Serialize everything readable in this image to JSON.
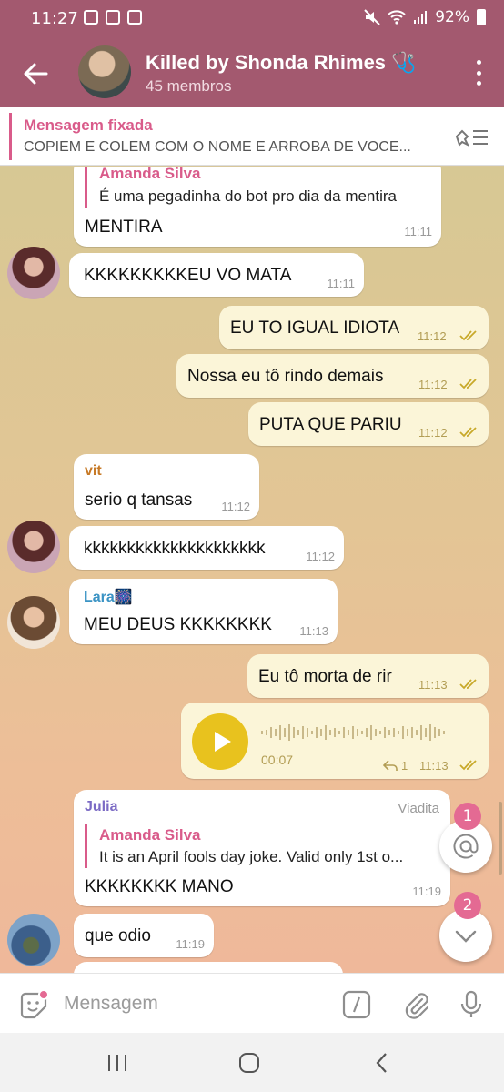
{
  "status_bar": {
    "time": "11:27",
    "battery": "92%"
  },
  "header": {
    "title": "Killed by Shonda Rhimes 🩺",
    "subtitle": "45 membros"
  },
  "pinned": {
    "label": "Mensagem fixada",
    "text": "COPIEM E COLEM COM O NOME E ARROBA DE VOCE..."
  },
  "messages": [
    {
      "id": "m0",
      "reply_name": "Amanda Silva",
      "reply_text": "É uma pegadinha do bot pro dia da mentira",
      "text": "MENTIRA",
      "time": "11:11"
    },
    {
      "id": "m1",
      "text": "KKKKKKKKKEU VO MATA",
      "time": "11:11"
    },
    {
      "id": "m2",
      "text": "EU TO IGUAL IDIOTA",
      "time": "11:12"
    },
    {
      "id": "m3",
      "text": "Nossa eu tô rindo demais",
      "time": "11:12"
    },
    {
      "id": "m4",
      "text": "PUTA QUE PARIU",
      "time": "11:12"
    },
    {
      "id": "m5",
      "sender": "vit",
      "text": "serio q tansas",
      "time": "11:12"
    },
    {
      "id": "m6",
      "text": "kkkkkkkkkkkkkkkkkkkkk",
      "time": "11:12"
    },
    {
      "id": "m7",
      "sender": "Lara🎆",
      "text": "MEU DEUS KKKKKKKK",
      "time": "11:13"
    },
    {
      "id": "m8",
      "text": "Eu tô morta de rir",
      "time": "11:13"
    },
    {
      "id": "m9",
      "voice_duration": "00:07",
      "reply_count": "1",
      "time": "11:13"
    },
    {
      "id": "m10",
      "sender": "Julia",
      "via": "Viadita",
      "reply_name": "Amanda Silva",
      "reply_text": "It is an April fools day joke. Valid only 1st o...",
      "text": "KKKKKKKK MANO",
      "time": "11:19"
    },
    {
      "id": "m11",
      "text": "que odio",
      "time": "11:19"
    }
  ],
  "fabs": {
    "mentions_badge": "1",
    "scroll_badge": "2"
  },
  "input": {
    "placeholder": "Mensagem"
  },
  "colors": {
    "header": "#a3596f",
    "accent": "#d95b8a",
    "outgoing": "#fbf5d8",
    "check": "#c8a92a"
  }
}
